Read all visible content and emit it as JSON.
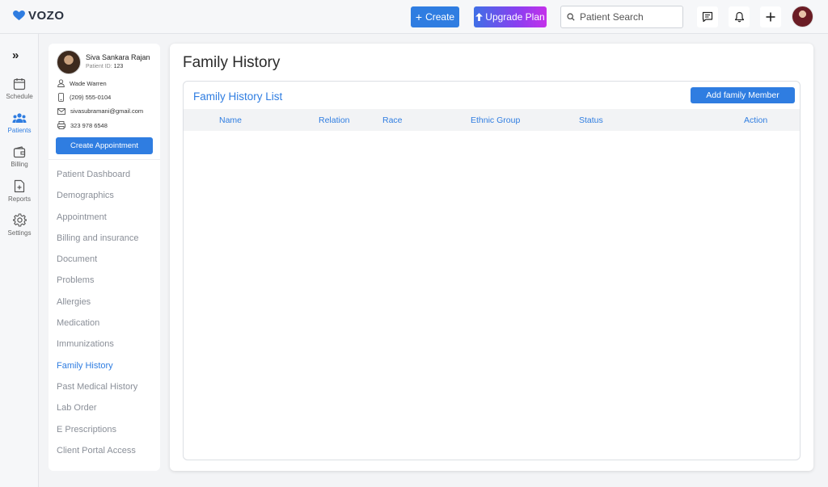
{
  "app": {
    "logo_text": "VOZO",
    "brand_color": "#2f7de1"
  },
  "header": {
    "create_label": "Create",
    "upgrade_label": "Upgrade Plan",
    "search_placeholder": "Patient Search"
  },
  "rail": {
    "items": [
      {
        "label": "Schedule",
        "icon": "calendar-icon"
      },
      {
        "label": "Patients",
        "icon": "users-icon",
        "active": true
      },
      {
        "label": "Billing",
        "icon": "wallet-icon"
      },
      {
        "label": "Reports",
        "icon": "report-icon"
      },
      {
        "label": "Settings",
        "icon": "gear-icon"
      }
    ]
  },
  "patient": {
    "name": "Siva Sankara Rajan",
    "id_label": "Patient ID:",
    "id_value": "123",
    "provider": "Wade Warren",
    "phone": "(209) 555-0104",
    "email": "sivasubramani@gmail.com",
    "fax": "323 978 6548",
    "create_appointment_label": "Create Appointment"
  },
  "nav": {
    "items": [
      "Patient Dashboard",
      "Demographics",
      "Appointment",
      "Billing and insurance",
      "Document",
      "Problems",
      "Allergies",
      "Medication",
      "Immunizations",
      "Family History",
      "Past Medical History",
      "Lab Order",
      "E Prescriptions",
      "Client Portal Access"
    ],
    "active": "Family History"
  },
  "main": {
    "title": "Family History",
    "list_title": "Family History List",
    "add_button_label": "Add family Member",
    "columns": [
      "Name",
      "Relation",
      "Race",
      "Ethnic Group",
      "Status",
      "Action"
    ],
    "rows": []
  }
}
